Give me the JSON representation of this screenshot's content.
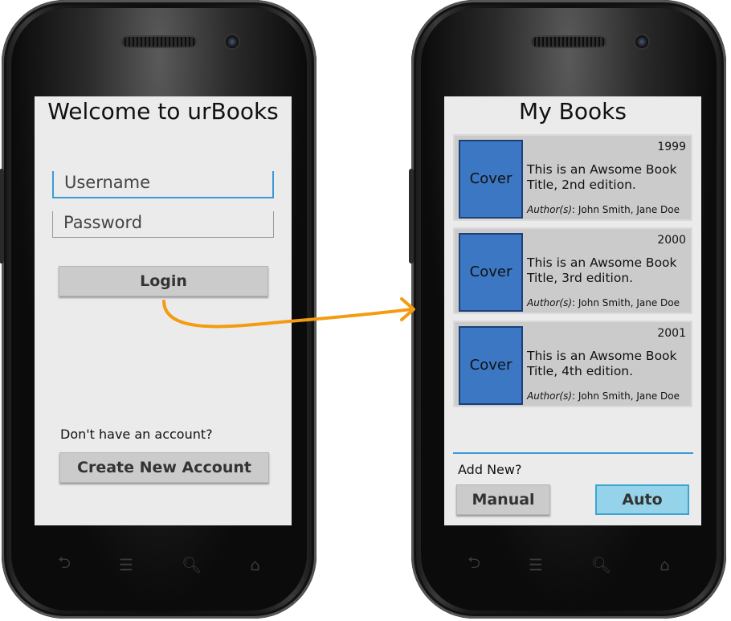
{
  "login_screen": {
    "title": "Welcome to urBooks",
    "username_placeholder": "Username",
    "password_placeholder": "Password",
    "login_label": "Login",
    "no_account_text": "Don't have an account?",
    "create_account_label": "Create New Account"
  },
  "books_screen": {
    "title": "My Books",
    "books": [
      {
        "cover": "Cover",
        "year": "1999",
        "title": "This is an Awsome Book Title, 2nd edition.",
        "authors_label": "Author(s)",
        "authors": ": John Smith, Jane Doe"
      },
      {
        "cover": "Cover",
        "year": "2000",
        "title": "This is an Awsome Book Title, 3rd edition.",
        "authors_label": "Author(s)",
        "authors": ": John Smith, Jane Doe"
      },
      {
        "cover": "Cover",
        "year": "2001",
        "title": "This is an Awsome Book Title, 4th edition.",
        "authors_label": "Author(s)",
        "authors": ": John Smith, Jane Doe"
      }
    ],
    "add_new_text": "Add New?",
    "manual_label": "Manual",
    "auto_label": "Auto"
  },
  "nav_icons": [
    "back-icon",
    "menu-icon",
    "search-icon",
    "home-icon"
  ],
  "colors": {
    "accent": "#3a9ad9",
    "cover": "#3b77c3",
    "auto_button": "#95d3ea",
    "flow_arrow": "#f39c12",
    "screen_bg": "#ebebeb"
  }
}
